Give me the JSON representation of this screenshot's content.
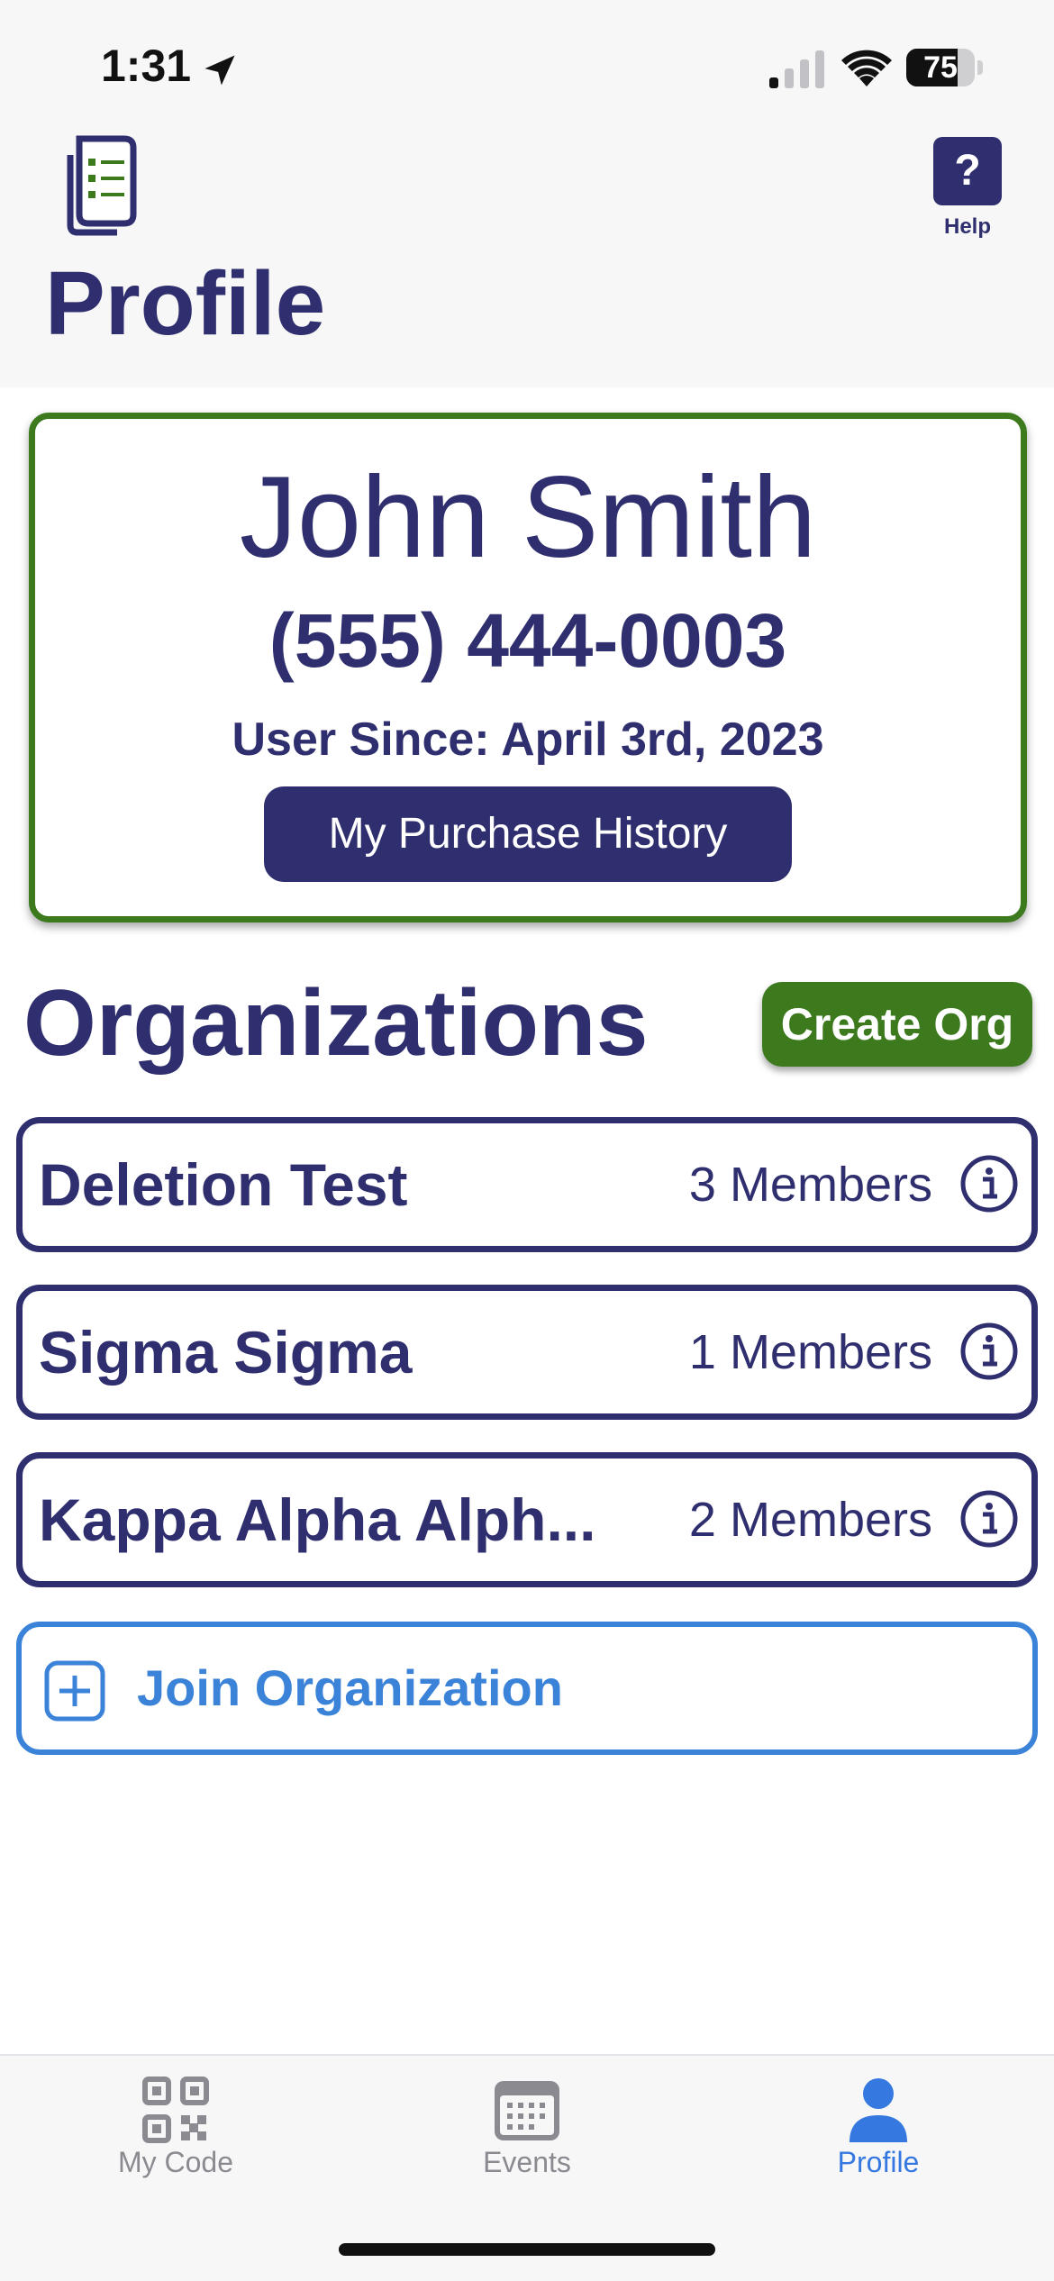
{
  "status_bar": {
    "time": "1:31",
    "battery_percent": 75,
    "battery_text": "75",
    "icons": [
      "location-arrow-icon",
      "cellular-signal-icon",
      "wifi-icon",
      "battery-icon"
    ]
  },
  "header": {
    "logo_icon": "checklist-document-icon",
    "help_glyph": "?",
    "help_label": "Help",
    "title": "Profile"
  },
  "profile": {
    "name": "John Smith",
    "phone": "(555) 444-0003",
    "user_since": "User Since: April 3rd, 2023",
    "purchase_history_label": "My Purchase History"
  },
  "organizations": {
    "title": "Organizations",
    "create_label": "Create Org",
    "items": [
      {
        "name": "Deletion Test",
        "members": "3 Members"
      },
      {
        "name": "Sigma Sigma",
        "members": "1 Members"
      },
      {
        "name": "Kappa Alpha Alph...",
        "members": "2 Members"
      }
    ],
    "join_label": "Join Organization"
  },
  "tabs": [
    {
      "label": "My Code",
      "icon": "qr-code-icon",
      "active": false
    },
    {
      "label": "Events",
      "icon": "calendar-icon",
      "active": false
    },
    {
      "label": "Profile",
      "icon": "person-icon",
      "active": true
    }
  ],
  "colors": {
    "brand_navy": "#2f2e6e",
    "accent_green": "#3d7a1e",
    "link_blue": "#3b83d8",
    "tab_active": "#3478e0",
    "tab_inactive": "#8a8a90"
  }
}
